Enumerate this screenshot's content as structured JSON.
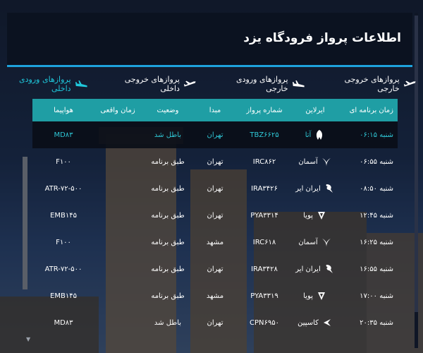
{
  "header": {
    "title": "اطلاعات پرواز فرودگاه یزد"
  },
  "tabs": [
    {
      "label": "پروازهای ورودی داخلی",
      "active": true,
      "icon": "plane-landing-icon"
    },
    {
      "label": "پروازهای خروجی داخلی",
      "active": false,
      "icon": "plane-takeoff-icon"
    },
    {
      "label": "پروازهای ورودی خارجی",
      "active": false,
      "icon": "plane-landing-icon"
    },
    {
      "label": "پروازهای خروجی خارجی",
      "active": false,
      "icon": "plane-takeoff-icon"
    }
  ],
  "table": {
    "headers": {
      "scheduled": "زمان برنامه ای",
      "airline": "ایرلاین",
      "flight": "شماره پرواز",
      "origin": "مبدا",
      "status": "وضعیت",
      "actual": "زمان واقعی",
      "aircraft": "هواپیما"
    },
    "rows": [
      {
        "scheduled": "شنبه ۰۶:۱۵",
        "airline": "آتا",
        "flight": "TBZ۶۶۲۵",
        "origin": "تهران",
        "status": "باطل شد",
        "actual": "",
        "aircraft": "MD۸۳"
      },
      {
        "scheduled": "شنبه ۰۶:۵۵",
        "airline": "آسمان",
        "flight": "IRC۸۶۲",
        "origin": "تهران",
        "status": "طبق برنامه",
        "actual": "",
        "aircraft": "F۱۰۰"
      },
      {
        "scheduled": "شنبه ۰۸:۵۰",
        "airline": "ایران ایر",
        "flight": "IRA۳۴۲۶",
        "origin": "تهران",
        "status": "طبق برنامه",
        "actual": "",
        "aircraft": "ATR-۷۲-۵۰۰"
      },
      {
        "scheduled": "شنبه ۱۲:۴۵",
        "airline": "پویا",
        "flight": "PYA۳۳۱۴",
        "origin": "تهران",
        "status": "طبق برنامه",
        "actual": "",
        "aircraft": "EMB۱۴۵"
      },
      {
        "scheduled": "شنبه ۱۶:۲۵",
        "airline": "آسمان",
        "flight": "IRC۶۱۸",
        "origin": "مشهد",
        "status": "طبق برنامه",
        "actual": "",
        "aircraft": "F۱۰۰"
      },
      {
        "scheduled": "شنبه ۱۶:۵۵",
        "airline": "ایران ایر",
        "flight": "IRA۳۴۲۸",
        "origin": "تهران",
        "status": "طبق برنامه",
        "actual": "",
        "aircraft": "ATR-۷۲-۵۰۰"
      },
      {
        "scheduled": "شنبه ۱۷:۰۰",
        "airline": "پویا",
        "flight": "PYA۳۳۱۹",
        "origin": "مشهد",
        "status": "طبق برنامه",
        "actual": "",
        "aircraft": "EMB۱۴۵"
      },
      {
        "scheduled": "شنبه ۲۰:۳۵",
        "airline": "کاسپین",
        "flight": "CPN۶۹۵۰",
        "origin": "تهران",
        "status": "باطل شد",
        "actual": "",
        "aircraft": "MD۸۳"
      }
    ]
  },
  "colors": {
    "accent": "#1ea2dc",
    "header_bar": "#1f9ea4",
    "highlight_text": "#2fc7d6"
  }
}
